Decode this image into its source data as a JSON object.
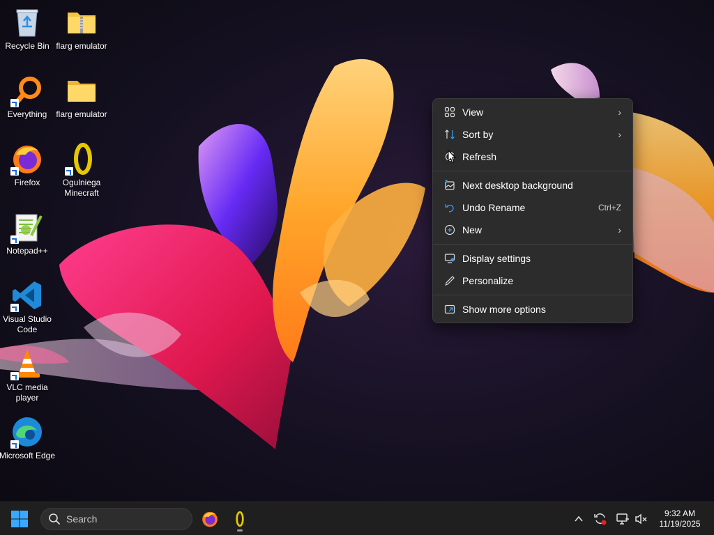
{
  "desktop": {
    "icons": [
      {
        "label": "Recycle Bin"
      },
      {
        "label": "flarg emulator"
      },
      {
        "label": "Everything"
      },
      {
        "label": "flarg emulator"
      },
      {
        "label": "Firefox"
      },
      {
        "label": "Ogulniega Minecraft"
      },
      {
        "label": "Notepad++"
      },
      {
        "label": "Visual Studio Code"
      },
      {
        "label": "VLC media player"
      },
      {
        "label": "Microsoft Edge"
      }
    ]
  },
  "context_menu": {
    "items": [
      {
        "label": "View",
        "icon": "grid-icon",
        "submenu": true
      },
      {
        "label": "Sort by",
        "icon": "sort-icon",
        "submenu": true
      },
      {
        "label": "Refresh",
        "icon": "refresh-icon"
      },
      {
        "label": "Next desktop background",
        "icon": "background-icon"
      },
      {
        "label": "Undo Rename",
        "icon": "undo-icon",
        "shortcut": "Ctrl+Z"
      },
      {
        "label": "New",
        "icon": "new-icon",
        "submenu": true
      },
      {
        "label": "Display settings",
        "icon": "display-icon"
      },
      {
        "label": "Personalize",
        "icon": "pen-icon"
      },
      {
        "label": "Show more options",
        "icon": "more-options-icon"
      }
    ]
  },
  "taskbar": {
    "search_placeholder": "Search",
    "clock_time": "9:32 AM",
    "clock_date": "11/19/2025"
  },
  "colors": {
    "menu_bg": "#2c2c2c",
    "taskbar_bg": "#1f1f1f",
    "accent_blue": "#3aa0ff"
  }
}
